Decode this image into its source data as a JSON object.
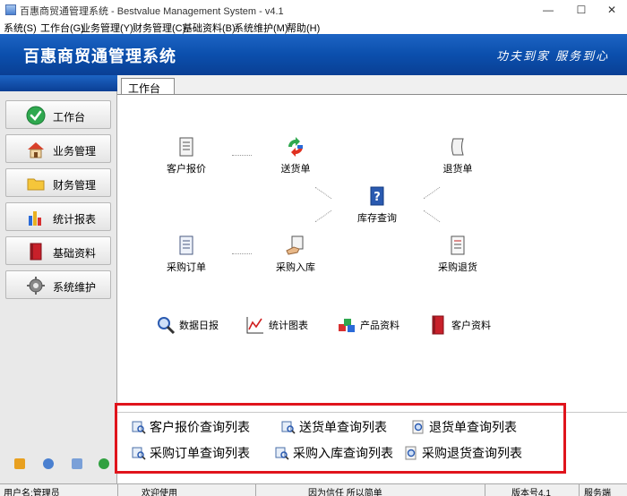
{
  "window": {
    "title": "百惠商贸通管理系统 - Bestvalue Management System - v4.1",
    "min_glyph": "—",
    "max_glyph": "☐",
    "close_glyph": "✕"
  },
  "menu": [
    "系统(S)",
    "工作台(G)",
    "业务管理(Y)",
    "财务管理(C)",
    "基础资料(B)",
    "系统维护(M)",
    "帮助(H)"
  ],
  "banner": {
    "title": "百惠商贸通管理系统",
    "slogan": "功夫到家 服务到心"
  },
  "sidebar": {
    "items": [
      {
        "label": "工作台",
        "icon": "checkmark-icon"
      },
      {
        "label": "业务管理",
        "icon": "house-icon"
      },
      {
        "label": "财务管理",
        "icon": "folder-icon"
      },
      {
        "label": "统计报表",
        "icon": "bar-chart-icon"
      },
      {
        "label": "基础资料",
        "icon": "book-icon"
      },
      {
        "label": "系统维护",
        "icon": "gear-icon"
      }
    ]
  },
  "tab": {
    "label": "工作台"
  },
  "workflow": {
    "customer_quote": "客户报价",
    "delivery_note": "送货单",
    "return_note": "退货单",
    "inventory_query": "库存查询",
    "purchase_order": "采购订单",
    "purchase_receipt": "采购入库",
    "purchase_return": "采购退货"
  },
  "quick": {
    "daily_report": "数据日报",
    "stats_chart": "统计图表",
    "product_info": "产品资料",
    "customer_info": "客户资料"
  },
  "links": {
    "quote_list": "客户报价查询列表",
    "delivery_list": "送货单查询列表",
    "return_list": "退货单查询列表",
    "po_list": "采购订单查询列表",
    "receipt_list": "采购入库查询列表",
    "preturn_list": "采购退货查询列表"
  },
  "status": {
    "user": "用户名:管理员",
    "welcome": "欢迎使用",
    "motto": "因为信任 所以简单",
    "version": "版本号4.1",
    "service": "服务端"
  },
  "colors": {
    "banner": "#0b4fad",
    "highlight": "#e0141c"
  }
}
